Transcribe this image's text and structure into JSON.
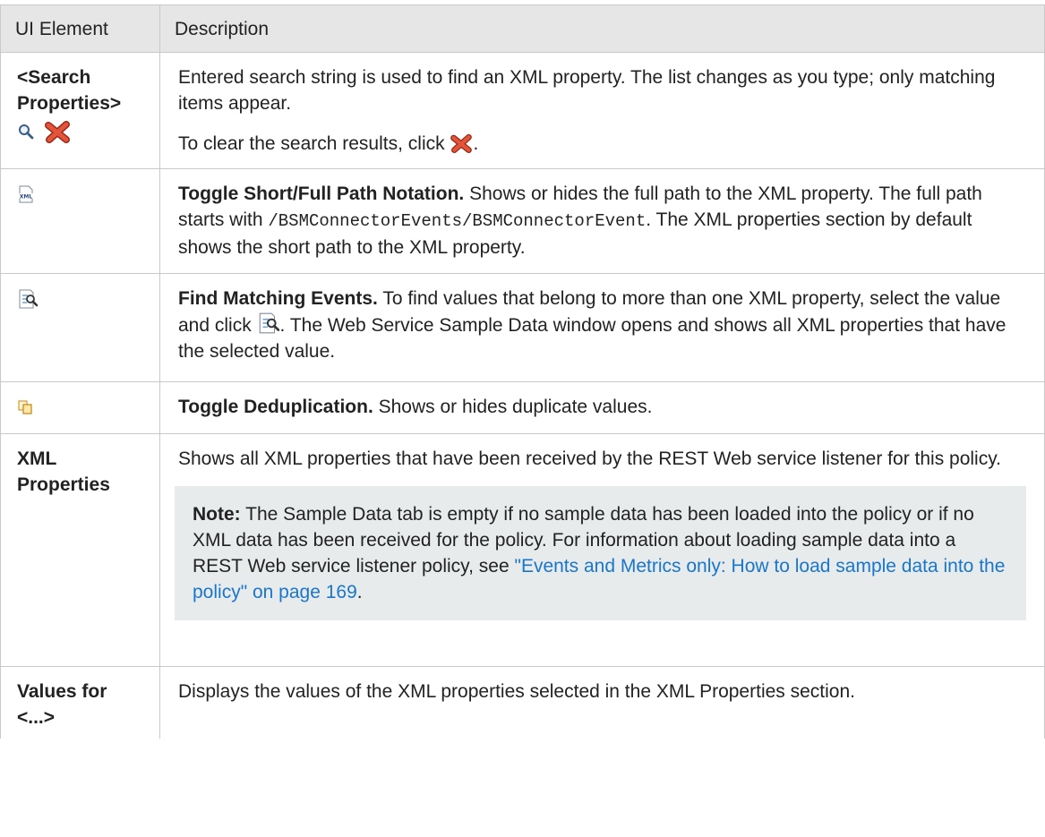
{
  "header": {
    "col1": "UI Element",
    "col2": "Description"
  },
  "rows": {
    "search": {
      "label": "<Search Properties>",
      "p1": "Entered search string is used to find an XML property. The list changes as you type; only matching items appear.",
      "p2_pre": "To clear the search results, click ",
      "p2_post": "."
    },
    "toggle_path": {
      "title": "Toggle Short/Full Path Notation.",
      "t1": " Shows or hides the full path to the XML property. The full path starts with ",
      "code": "/BSMConnectorEvents/BSMConnectorEvent",
      "t2": ". The XML properties section by default shows the short path to the XML property."
    },
    "find_matching": {
      "title": "Find Matching Events.",
      "t1": " To find values that belong to more than one XML property, select the value and click ",
      "t2": ". The Web Service Sample Data window opens and shows all XML properties that have the selected value."
    },
    "dedup": {
      "title": "Toggle Deduplication.",
      "t1": " Shows or hides duplicate values."
    },
    "xml_props": {
      "label": "XML Properties",
      "p1": "Shows all XML properties that have been received by the REST Web service listener for this policy.",
      "note_label": "Note:",
      "note_text": " The Sample Data tab is empty if no sample data has been loaded into the policy or if no XML data has been received for the policy. For information about loading sample data into a REST Web service listener policy, see ",
      "note_link": "\"Events and Metrics only: How to load sample data into the policy\" on page 169",
      "note_end": "."
    },
    "values_for": {
      "label": "Values for <...>",
      "p1": "Displays the values of the XML properties selected in the XML Properties section."
    }
  },
  "icons": {
    "search": "magnifier-icon",
    "clear": "red-x-icon",
    "xml": "xml-path-icon",
    "find": "find-matching-icon",
    "dedup": "deduplication-icon"
  },
  "colors": {
    "link": "#1a76c9",
    "header_bg": "#e6e6e6",
    "note_bg": "#e8ebec",
    "clear_red": "#d9432a"
  }
}
